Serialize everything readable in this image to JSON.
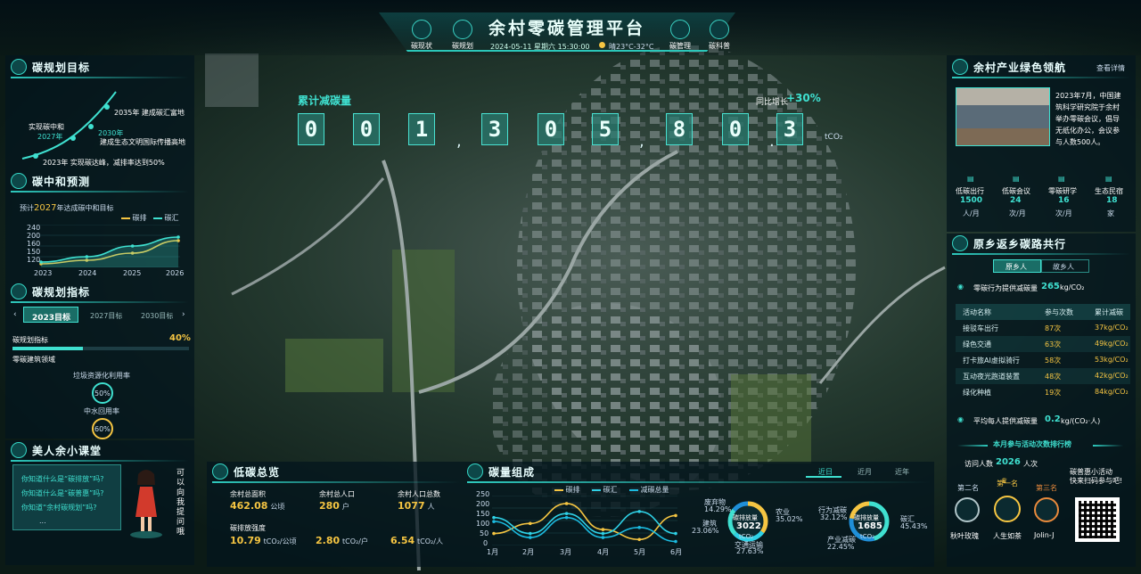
{
  "header": {
    "title": "余村零碳管理平台",
    "datetime": "2024-05-11 星期六 15:30:00",
    "weather": "晴23°C-32°C",
    "nav": [
      "碳现状",
      "碳规划",
      "碳管理",
      "碳科普"
    ]
  },
  "goal": {
    "title": "碳规划目标",
    "items": [
      "2035年  建成碳汇富地",
      "2030年",
      "建成生态文明国际传播高地",
      "实现碳中和",
      "2027年",
      "2023年  实现碳达峰，减排率达到50%"
    ]
  },
  "forecast": {
    "title": "碳中和预测",
    "subtitle_pre": "预计",
    "subtitle_year": "2027",
    "subtitle_post": "年达成碳中和目标",
    "legend": [
      "碳排",
      "碳汇"
    ],
    "yticks": [
      "240",
      "200",
      "160",
      "150",
      "120"
    ],
    "xticks": [
      "2023",
      "2024",
      "2025",
      "2026"
    ]
  },
  "indicators": {
    "title": "碳规划指标",
    "tabs": [
      "2023目标",
      "2027目标",
      "2030目标"
    ],
    "metric": "碳规划指标",
    "metric_value": "40%",
    "fill": 0.4,
    "section": "零碳建筑领域",
    "ring1_label": "垃圾资源化利用率",
    "ring1_value": "50%",
    "ring2_label": "中水回用率",
    "ring2_value": "60%"
  },
  "class": {
    "title": "美人余小课堂",
    "q": [
      "你知道什么是“碳排放”吗?",
      "你知道什么是“碳普惠”吗?",
      "你知道“余村碳规划”吗?",
      "..."
    ],
    "vertical": "可以向我提问哦"
  },
  "counter": {
    "label": "累计减碳量",
    "digits": [
      "0",
      "0",
      "1",
      "3",
      "0",
      "5",
      "8",
      "0",
      "3"
    ],
    "separators": [
      ",",
      ",",
      "."
    ],
    "unit": "tCO₂",
    "yoy_label": "同比增长",
    "yoy_value": "+30%"
  },
  "lowcarbon": {
    "title": "低碳总览",
    "area_label": "余村总面积",
    "area_value": "462.08",
    "area_unit": "公顷",
    "pop_label": "余村总人口",
    "pop_value": "280",
    "pop_unit": "户",
    "people_label": "余村人口总数",
    "people_value": "1077",
    "people_unit": "人",
    "intensity_label": "碳排放强度",
    "i1": "10.79",
    "i1u": "tCO₂/公顷",
    "i2": "2.80",
    "i2u": "tCO₂/户",
    "i3": "6.54",
    "i3u": "tCO₂/人"
  },
  "composition": {
    "title": "碳量组成",
    "tabs": [
      "近日",
      "近月",
      "近年"
    ],
    "legend": [
      "碳排",
      "碳汇",
      "减碳总量"
    ],
    "yticks": [
      "250",
      "200",
      "150",
      "100",
      "50",
      "0"
    ],
    "xticks": [
      "1月",
      "2月",
      "3月",
      "4月",
      "5月",
      "6月"
    ]
  },
  "chart_data": [
    {
      "type": "line",
      "title": "",
      "x": [
        "2023",
        "2024",
        "2025",
        "2026"
      ],
      "series": [
        {
          "name": "碳排",
          "values": [
            130,
            140,
            160,
            195
          ]
        },
        {
          "name": "碳汇",
          "values": [
            135,
            150,
            180,
            205
          ]
        }
      ],
      "ylim": [
        120,
        240
      ]
    },
    {
      "type": "line",
      "title": "",
      "x": [
        "1月",
        "2月",
        "3月",
        "4月",
        "5月",
        "6月"
      ],
      "series": [
        {
          "name": "碳排",
          "values": [
            60,
            110,
            210,
            80,
            30,
            150
          ]
        },
        {
          "name": "碳汇",
          "values": [
            140,
            60,
            160,
            60,
            170,
            60
          ]
        },
        {
          "name": "减碳总量",
          "values": [
            120,
            40,
            140,
            40,
            90,
            20
          ]
        }
      ],
      "ylim": [
        0,
        250
      ]
    },
    {
      "type": "pie",
      "title": "碳排放量",
      "center_value": "3022",
      "center_unit": "tCO₂",
      "slices": [
        {
          "name": "农业",
          "value": 35.02
        },
        {
          "name": "交通运输",
          "value": 27.63
        },
        {
          "name": "建筑",
          "value": 23.06
        },
        {
          "name": "废弃物",
          "value": 14.29
        }
      ]
    },
    {
      "type": "pie",
      "title": "碳排放量",
      "center_value": "1685",
      "center_unit": "tCO₂",
      "slices": [
        {
          "name": "碳汇",
          "value": 45.43
        },
        {
          "name": "行为减碳",
          "value": 32.12
        },
        {
          "name": "产业减碳",
          "value": 22.45
        }
      ]
    }
  ],
  "donut1": {
    "title": "碳排放量",
    "value": "3022",
    "unit": "tCO₂",
    "l1": "废弃物",
    "l1v": "14.29%",
    "l2": "农业",
    "l2v": "35.02%",
    "l3": "建筑",
    "l3v": "23.06%",
    "l4": "交通运输",
    "l4v": "27.63%"
  },
  "donut2": {
    "title": "碳排放量",
    "value": "1685",
    "unit": "tCO₂",
    "l1": "行为减碳",
    "l1v": "32.12%",
    "l2": "碳汇",
    "l2v": "45.43%",
    "l3": "产业减碳",
    "l3v": "22.45%"
  },
  "news": {
    "title": "余村产业绿色领航",
    "more": "查看详情",
    "text": [
      "2023年7月，中国建",
      "筑科学研究院于余村",
      "举办零碳会议，倡导",
      "无纸化办公，会议参",
      "与人数500人。"
    ],
    "stats": [
      {
        "label": "低碳出行",
        "value": "1500",
        "unit": "人/月"
      },
      {
        "label": "低碳会议",
        "value": "24",
        "unit": "次/月"
      },
      {
        "label": "零碳研学",
        "value": "16",
        "unit": "次/月"
      },
      {
        "label": "生态民宿",
        "value": "18",
        "unit": "家"
      }
    ]
  },
  "coop": {
    "title": "原乡返乡碳路共行",
    "tabs": [
      "原乡人",
      "故乡人"
    ],
    "summary_label": "零碳行为提供减碳量",
    "summary_value": "265",
    "summary_unit": "kg/CO₂",
    "headers": [
      "活动名称",
      "参与次数",
      "累计减碳"
    ],
    "rows": [
      [
        "接驳车出行",
        "87次",
        "37kg/CO₂"
      ],
      [
        "绿色交通",
        "63次",
        "49kg/CO₂"
      ],
      [
        "打卡旅AI虚拟骑行",
        "58次",
        "53kg/CO₂"
      ],
      [
        "互动夜光跑道装置",
        "48次",
        "42kg/CO₂"
      ],
      [
        "绿化种植",
        "19次",
        "84kg/CO₂"
      ]
    ],
    "avg_label": "平均每人提供减碳量",
    "avg_value": "0.2",
    "avg_unit": "kg/(CO₂·人)",
    "rank_title": "本月参与活动次数排行榜",
    "visits_label": "访问人数",
    "visits_value": "2026",
    "visits_unit": "人次",
    "ranks": [
      {
        "place": "第二名",
        "name": "秋叶玫瑰"
      },
      {
        "place": "第一名",
        "name": "人生如茶"
      },
      {
        "place": "第三名",
        "name": "Jolin-J"
      }
    ],
    "qr_text": [
      "碳普惠小活动",
      "快来扫码参与吧!"
    ]
  }
}
